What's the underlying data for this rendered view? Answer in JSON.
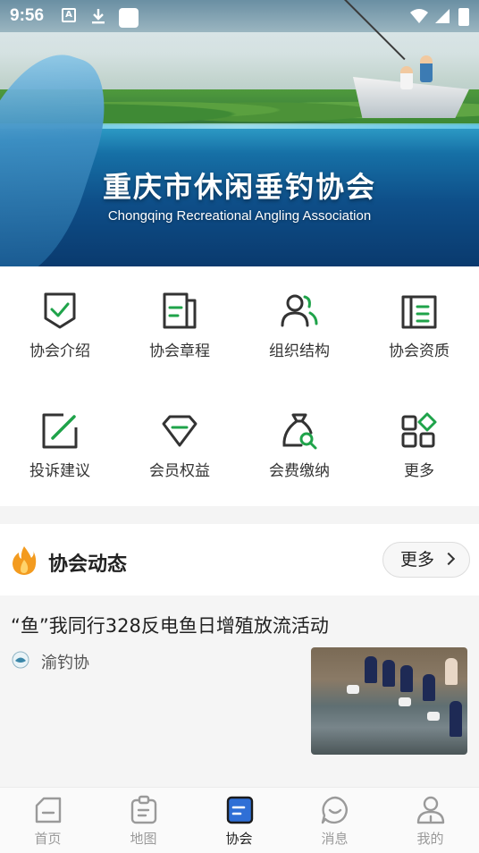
{
  "status_bar": {
    "time": "9:56",
    "app_icon_letter": "A"
  },
  "banner": {
    "title": "重庆市休闲垂钓协会",
    "subtitle": "Chongqing Recreational Angling Association"
  },
  "grid": [
    {
      "label": "协会介绍",
      "icon": "shield-check-icon"
    },
    {
      "label": "协会章程",
      "icon": "document-icon"
    },
    {
      "label": "组织结构",
      "icon": "people-icon"
    },
    {
      "label": "协会资质",
      "icon": "certificate-icon"
    },
    {
      "label": "投诉建议",
      "icon": "edit-icon"
    },
    {
      "label": "会员权益",
      "icon": "diamond-icon"
    },
    {
      "label": "会费缴纳",
      "icon": "money-bag-icon"
    },
    {
      "label": "更多",
      "icon": "apps-icon"
    }
  ],
  "section": {
    "title": "协会动态",
    "more_label": "更多"
  },
  "news": [
    {
      "title": "“鱼”我同行328反电鱼日增殖放流活动",
      "source": "渝钓协"
    }
  ],
  "tabs": [
    {
      "label": "首页",
      "icon": "home-icon",
      "active": false
    },
    {
      "label": "地图",
      "icon": "map-icon",
      "active": false
    },
    {
      "label": "协会",
      "icon": "association-icon",
      "active": true
    },
    {
      "label": "消息",
      "icon": "message-icon",
      "active": false
    },
    {
      "label": "我的",
      "icon": "profile-icon",
      "active": false
    }
  ],
  "colors": {
    "accent_green": "#1fa34a",
    "dark_icon": "#333333",
    "active_tab": "#2f6fd6",
    "flame": "#f39b1f"
  }
}
